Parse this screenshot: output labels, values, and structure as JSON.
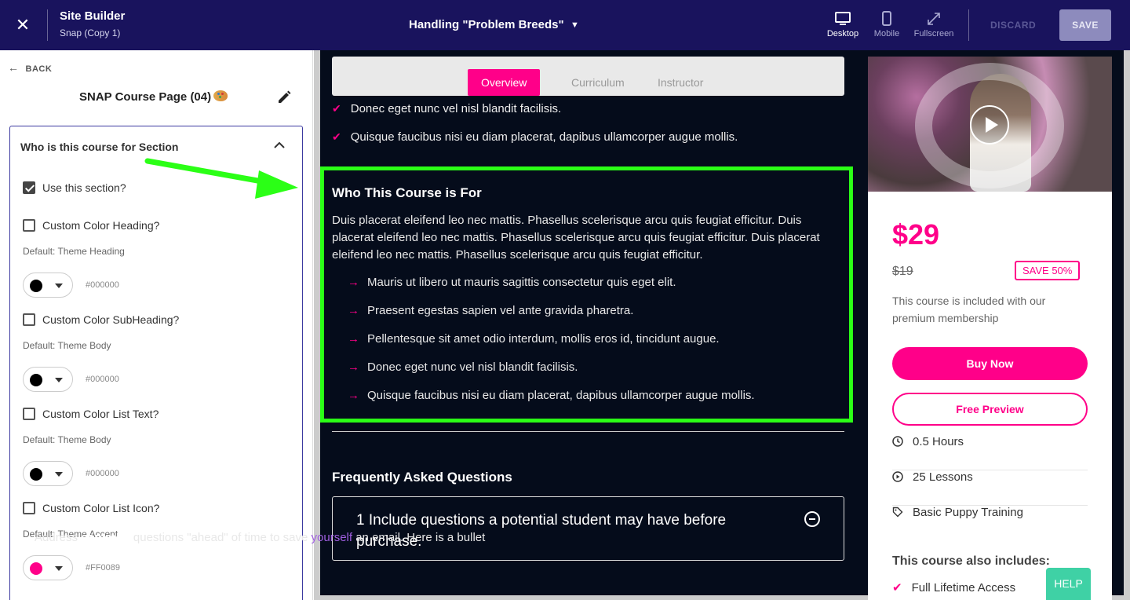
{
  "topbar": {
    "title": "Site Builder",
    "subtitle": "Snap (Copy 1)",
    "page_selector": "Handling \"Problem Breeds\"",
    "views": [
      {
        "label": "Desktop",
        "icon": "desktop-icon",
        "active": true
      },
      {
        "label": "Mobile",
        "icon": "mobile-icon",
        "active": false
      },
      {
        "label": "Fullscreen",
        "icon": "fullscreen-icon",
        "active": false
      }
    ],
    "discard_label": "DISCARD",
    "save_label": "SAVE"
  },
  "sidebar": {
    "back_label": "BACK",
    "page_title": "SNAP Course Page (04)",
    "section": {
      "title": "Who is this course for Section",
      "use_section": {
        "label": "Use this section?",
        "checked": true
      },
      "options": [
        {
          "label": "Custom Color Heading?",
          "default": "Default: Theme Heading",
          "hex": "#000000",
          "color": "#000000"
        },
        {
          "label": "Custom Color SubHeading?",
          "default": "Default: Theme Body",
          "hex": "#000000",
          "color": "#000000"
        },
        {
          "label": "Custom Color List Text?",
          "default": "Default: Theme Body",
          "hex": "#000000",
          "color": "#000000"
        },
        {
          "label": "Custom Color List Icon?",
          "default": "Default: Theme Accent",
          "hex": "#FF0089",
          "color": "#FF0089"
        }
      ]
    }
  },
  "preview": {
    "tabs": [
      "Overview",
      "Curriculum",
      "Instructor"
    ],
    "active_tab": "Overview",
    "checklist": [
      "Donec eget nunc vel nisl blandit facilisis.",
      "Quisque faucibus nisi eu diam placerat, dapibus ullamcorper augue mollis."
    ],
    "who": {
      "heading": "Who This Course is For",
      "paragraph": "Duis placerat eleifend leo nec mattis. Phasellus scelerisque arcu quis feugiat efficitur. Duis placerat eleifend leo nec mattis. Phasellus scelerisque arcu quis feugiat efficitur. Duis placerat eleifend leo nec mattis. Phasellus scelerisque arcu quis feugiat efficitur.",
      "items": [
        "Mauris ut libero ut mauris sagittis consectetur quis eget elit.",
        "Praesent egestas sapien vel ante gravida pharetra.",
        "Pellentesque sit amet odio interdum, mollis eros id, tincidunt augue.",
        "Donec eget nunc vel nisl blandit facilisis.",
        "Quisque faucibus nisi eu diam placerat, dapibus ullamcorper augue mollis."
      ]
    },
    "faq": {
      "heading": "Frequently Asked Questions",
      "question": "1 Include questions a potential student may have before purchase.",
      "answer_pre": "Address ",
      "answer_bold": "common",
      "answer_mid": " questions \"ahead\" of time to save ",
      "answer_link": "yourself",
      "answer_post": " an email. Here is a bullet"
    }
  },
  "course_card": {
    "price": "$29",
    "old_price": "$19",
    "badge": "SAVE 50%",
    "included_text": "This course is included with our premium membership",
    "buy_label": "Buy Now",
    "preview_label": "Free Preview",
    "meta": [
      {
        "icon": "clock-icon",
        "label": "0.5 Hours"
      },
      {
        "icon": "play-circle-icon",
        "label": "25 Lessons"
      },
      {
        "icon": "tag-icon",
        "label": "Basic Puppy Training"
      }
    ],
    "also_heading": "This course also includes:",
    "also_items": [
      "Full Lifetime Access"
    ]
  },
  "help_label": "HELP",
  "colors": {
    "accent": "#FF0089",
    "topbar": "#19135d",
    "highlight": "#2bff16",
    "dark_bg": "#050c1b"
  }
}
